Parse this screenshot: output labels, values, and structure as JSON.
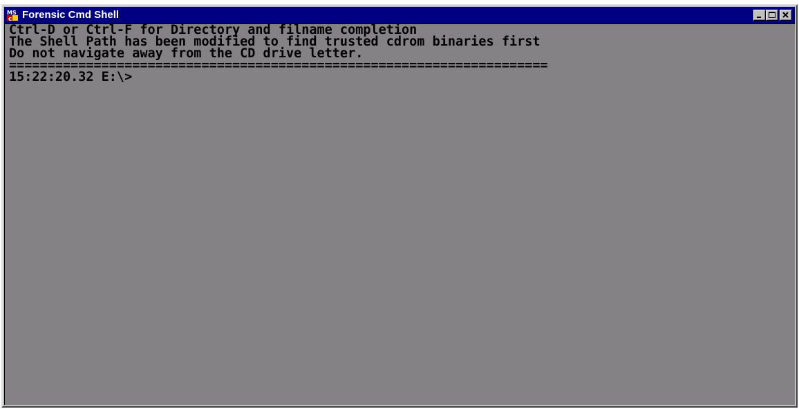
{
  "window": {
    "title": "Forensic Cmd Shell",
    "icon": "ms-dos-icon",
    "controls": [
      "minimize-icon",
      "maximize-icon",
      "close-icon"
    ]
  },
  "console": {
    "lines": [
      "Ctrl-D or Ctrl-F for Directory and filname completion",
      "The Shell Path has been modified to find trusted cdrom binaries first",
      "Do not navigate away from the CD drive letter.",
      "======================================================================",
      "15:22:20.32 E:\\>"
    ]
  },
  "colors": {
    "titlebar": "#000080",
    "console_background": "#848284",
    "console_text": "#000000",
    "chrome": "#c0c0c0"
  }
}
